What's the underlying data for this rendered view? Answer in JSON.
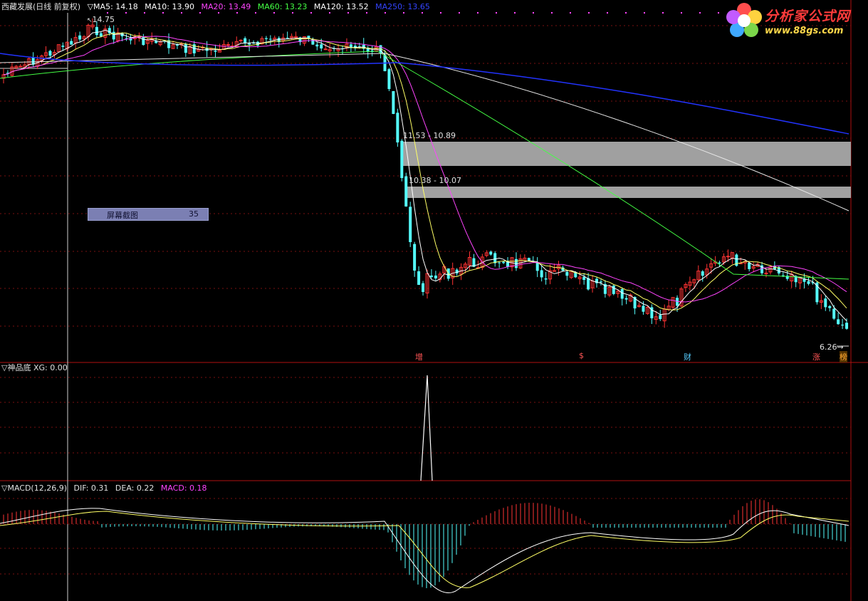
{
  "main_header": {
    "title": "西藏发展(日线 前复权)",
    "mas": [
      {
        "text": "▽MA5: 14.18",
        "color": "#ffffff"
      },
      {
        "text": "MA10: 13.90",
        "color": "#ffffff"
      },
      {
        "text": "MA20: 13.49",
        "color": "#ff44ff"
      },
      {
        "text": "MA60: 13.23",
        "color": "#44ff44"
      },
      {
        "text": "MA120: 13.52",
        "color": "#ffffff"
      },
      {
        "text": "MA250: 13.65",
        "color": "#3344ff"
      }
    ]
  },
  "price_labels": {
    "high": "14.75",
    "low": "6.26→",
    "zone1": "11.53 - 10.89",
    "zone2": "10.38 - 10.07"
  },
  "screenshot_box": {
    "label": "屏幕截图",
    "value": "35"
  },
  "event_markers": [
    {
      "text": "增",
      "color": "#ff5555"
    },
    {
      "text": "$",
      "color": "#ff5555"
    },
    {
      "text": "财",
      "color": "#55ccff"
    },
    {
      "text": "涨",
      "color": "#ff5555"
    },
    {
      "text": "榜",
      "color": "#ffaa33"
    }
  ],
  "panel2_header": "▽神品底 XG: 0.00",
  "panel3_header": {
    "prefix": "▽MACD(12,26,9)",
    "dif": "DIF: 0.31",
    "dea": "DEA: 0.22",
    "macd": "MACD: 0.18",
    "macd_color": "#ff44ff"
  },
  "logo": {
    "title": "分析家公式网",
    "url": "www.88gs.com"
  },
  "colors": {
    "up": "#ff3333",
    "down": "#55ffff",
    "grid": "#7a1010",
    "ma250": "#2233ff",
    "ma60": "#44ff44",
    "ma20": "#ff44ff"
  }
}
